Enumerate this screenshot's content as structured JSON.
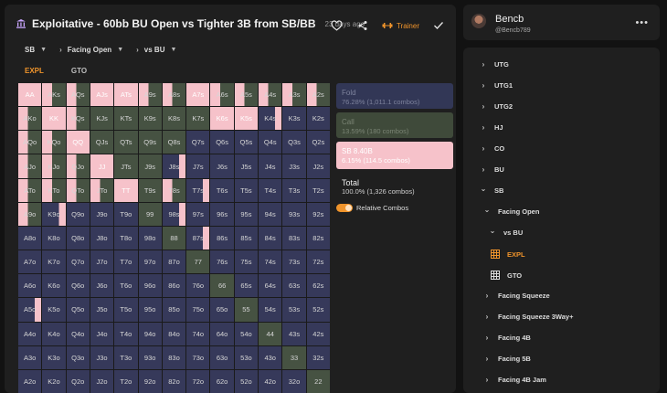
{
  "header": {
    "title": "Exploitative - 60bb BU Open vs Tighter 3B from SB/BB",
    "age": "23 days ago",
    "trainer_label": "Trainer"
  },
  "filters": [
    {
      "label": "SB"
    },
    {
      "label": "Facing Open"
    },
    {
      "label": "vs BU"
    }
  ],
  "modes": {
    "expl": "EXPL",
    "gto": "GTO"
  },
  "grid": {
    "hands": [
      [
        "AA",
        "AKs",
        "AQs",
        "AJs",
        "ATs",
        "A9s",
        "A8s",
        "A7s",
        "A6s",
        "A5s",
        "A4s",
        "A3s",
        "A2s"
      ],
      [
        "AKo",
        "KK",
        "KQs",
        "KJs",
        "KTs",
        "K9s",
        "K8s",
        "K7s",
        "K6s",
        "K5s",
        "K4s",
        "K3s",
        "K2s"
      ],
      [
        "AQo",
        "KQo",
        "QQ",
        "QJs",
        "QTs",
        "Q9s",
        "Q8s",
        "Q7s",
        "Q6s",
        "Q5s",
        "Q4s",
        "Q3s",
        "Q2s"
      ],
      [
        "AJo",
        "KJo",
        "QJo",
        "JJ",
        "JTs",
        "J9s",
        "J8s",
        "J7s",
        "J6s",
        "J5s",
        "J4s",
        "J3s",
        "J2s"
      ],
      [
        "ATo",
        "KTo",
        "QTo",
        "JTo",
        "TT",
        "T9s",
        "T8s",
        "T7s",
        "T6s",
        "T5s",
        "T4s",
        "T3s",
        "T2s"
      ],
      [
        "A9o",
        "K9o",
        "Q9o",
        "J9o",
        "T9o",
        "99",
        "98s",
        "97s",
        "96s",
        "95s",
        "94s",
        "93s",
        "92s"
      ],
      [
        "A8o",
        "K8o",
        "Q8o",
        "J8o",
        "T8o",
        "98o",
        "88",
        "87s",
        "86s",
        "85s",
        "84s",
        "83s",
        "82s"
      ],
      [
        "A7o",
        "K7o",
        "Q7o",
        "J7o",
        "T7o",
        "97o",
        "87o",
        "77",
        "76s",
        "75s",
        "74s",
        "73s",
        "72s"
      ],
      [
        "A6o",
        "K6o",
        "Q6o",
        "J6o",
        "T6o",
        "96o",
        "86o",
        "76o",
        "66",
        "65s",
        "64s",
        "63s",
        "62s"
      ],
      [
        "A5o",
        "K5o",
        "Q5o",
        "J5o",
        "T5o",
        "95o",
        "85o",
        "75o",
        "65o",
        "55",
        "54s",
        "53s",
        "52s"
      ],
      [
        "A4o",
        "K4o",
        "Q4o",
        "J4o",
        "T4o",
        "94o",
        "84o",
        "74o",
        "64o",
        "54o",
        "44",
        "43s",
        "42s"
      ],
      [
        "A3o",
        "K3o",
        "Q3o",
        "J3o",
        "T3o",
        "93o",
        "83o",
        "73o",
        "63o",
        "53o",
        "43o",
        "33",
        "32s"
      ],
      [
        "A2o",
        "K2o",
        "Q2o",
        "J2o",
        "T2o",
        "92o",
        "82o",
        "72o",
        "62o",
        "52o",
        "42o",
        "32o",
        "22"
      ]
    ],
    "styles": [
      [
        "raise",
        "mixrc",
        "mixrc",
        "raise",
        "raise",
        "mixrc",
        "mixrc",
        "raise",
        "mixrc",
        "mixrc",
        "mixrc",
        "mixrc",
        "mixrc"
      ],
      [
        "mixrc",
        "raise",
        "mixrc",
        "call",
        "call",
        "call",
        "call",
        "call",
        "raise",
        "raise",
        "mixfr",
        "fold",
        "fold"
      ],
      [
        "mixrc",
        "mixrc",
        "raise",
        "call",
        "call",
        "call",
        "call",
        "fold",
        "fold",
        "fold",
        "fold",
        "fold",
        "fold"
      ],
      [
        "mixrc",
        "mixrc",
        "mixrc",
        "raise",
        "call",
        "call",
        "mixfr",
        "fold",
        "fold",
        "fold",
        "fold",
        "fold",
        "fold"
      ],
      [
        "mixrc",
        "mixrc",
        "mixrc",
        "mixrc",
        "raise",
        "call",
        "mixrc",
        "mixfr",
        "fold",
        "fold",
        "fold",
        "fold",
        "fold"
      ],
      [
        "mixrc",
        "mixfr",
        "fold",
        "fold",
        "fold",
        "call",
        "mixfr",
        "fold",
        "fold",
        "fold",
        "fold",
        "fold",
        "fold"
      ],
      [
        "fold",
        "fold",
        "fold",
        "fold",
        "fold",
        "fold",
        "call",
        "mixfr",
        "fold",
        "fold",
        "fold",
        "fold",
        "fold"
      ],
      [
        "fold",
        "fold",
        "fold",
        "fold",
        "fold",
        "fold",
        "fold",
        "call",
        "fold",
        "fold",
        "fold",
        "fold",
        "fold"
      ],
      [
        "fold",
        "fold",
        "fold",
        "fold",
        "fold",
        "fold",
        "fold",
        "fold",
        "call",
        "fold",
        "fold",
        "fold",
        "fold"
      ],
      [
        "mixfr",
        "fold",
        "fold",
        "fold",
        "fold",
        "fold",
        "fold",
        "fold",
        "fold",
        "call",
        "fold",
        "fold",
        "fold"
      ],
      [
        "fold",
        "fold",
        "fold",
        "fold",
        "fold",
        "fold",
        "fold",
        "fold",
        "fold",
        "fold",
        "call",
        "fold",
        "fold"
      ],
      [
        "fold",
        "fold",
        "fold",
        "fold",
        "fold",
        "fold",
        "fold",
        "fold",
        "fold",
        "fold",
        "fold",
        "call",
        "fold"
      ],
      [
        "fold",
        "fold",
        "fold",
        "fold",
        "fold",
        "fold",
        "fold",
        "fold",
        "fold",
        "fold",
        "fold",
        "fold",
        "call"
      ]
    ]
  },
  "colors": {
    "fold": "#36395a",
    "call": "#465242",
    "raise": "#f6c2ca",
    "accent": "#f0942b"
  },
  "actions": [
    {
      "name": "Fold",
      "stat": "76.28% (1,011.1 combos)",
      "style": "box-fold"
    },
    {
      "name": "Call",
      "stat": "13.59% (180 combos)",
      "style": "box-call"
    },
    {
      "name": "SB 8.40B",
      "stat": "6.15% (114.5 combos)",
      "style": "box-raise"
    },
    {
      "name": "Total",
      "stat": "100.0% (1,326 combos)",
      "style": "box-total"
    }
  ],
  "relative_combos_label": "Relative Combos",
  "user": {
    "name": "Bencb",
    "handle": "@Bencb789"
  },
  "tree": [
    {
      "label": "UTG",
      "depth": 0,
      "icon": "chevron-right"
    },
    {
      "label": "UTG1",
      "depth": 0,
      "icon": "chevron-right"
    },
    {
      "label": "UTG2",
      "depth": 0,
      "icon": "chevron-right"
    },
    {
      "label": "HJ",
      "depth": 0,
      "icon": "chevron-right"
    },
    {
      "label": "CO",
      "depth": 0,
      "icon": "chevron-right"
    },
    {
      "label": "BU",
      "depth": 0,
      "icon": "chevron-right"
    },
    {
      "label": "SB",
      "depth": 0,
      "icon": "chevron-down"
    },
    {
      "label": "Facing Open",
      "depth": 1,
      "icon": "chevron-down"
    },
    {
      "label": "vs BU",
      "depth": 2,
      "icon": "chevron-down"
    },
    {
      "label": "EXPL",
      "depth": 3,
      "icon": "grid",
      "active": true
    },
    {
      "label": "GTO",
      "depth": 3,
      "icon": "grid"
    },
    {
      "label": "Facing Squeeze",
      "depth": 1,
      "icon": "chevron-right"
    },
    {
      "label": "Facing Squeeze 3Way+",
      "depth": 1,
      "icon": "chevron-right"
    },
    {
      "label": "Facing 4B",
      "depth": 1,
      "icon": "chevron-right"
    },
    {
      "label": "Facing 5B",
      "depth": 1,
      "icon": "chevron-right"
    },
    {
      "label": "Facing 4B Jam",
      "depth": 1,
      "icon": "chevron-right"
    }
  ]
}
